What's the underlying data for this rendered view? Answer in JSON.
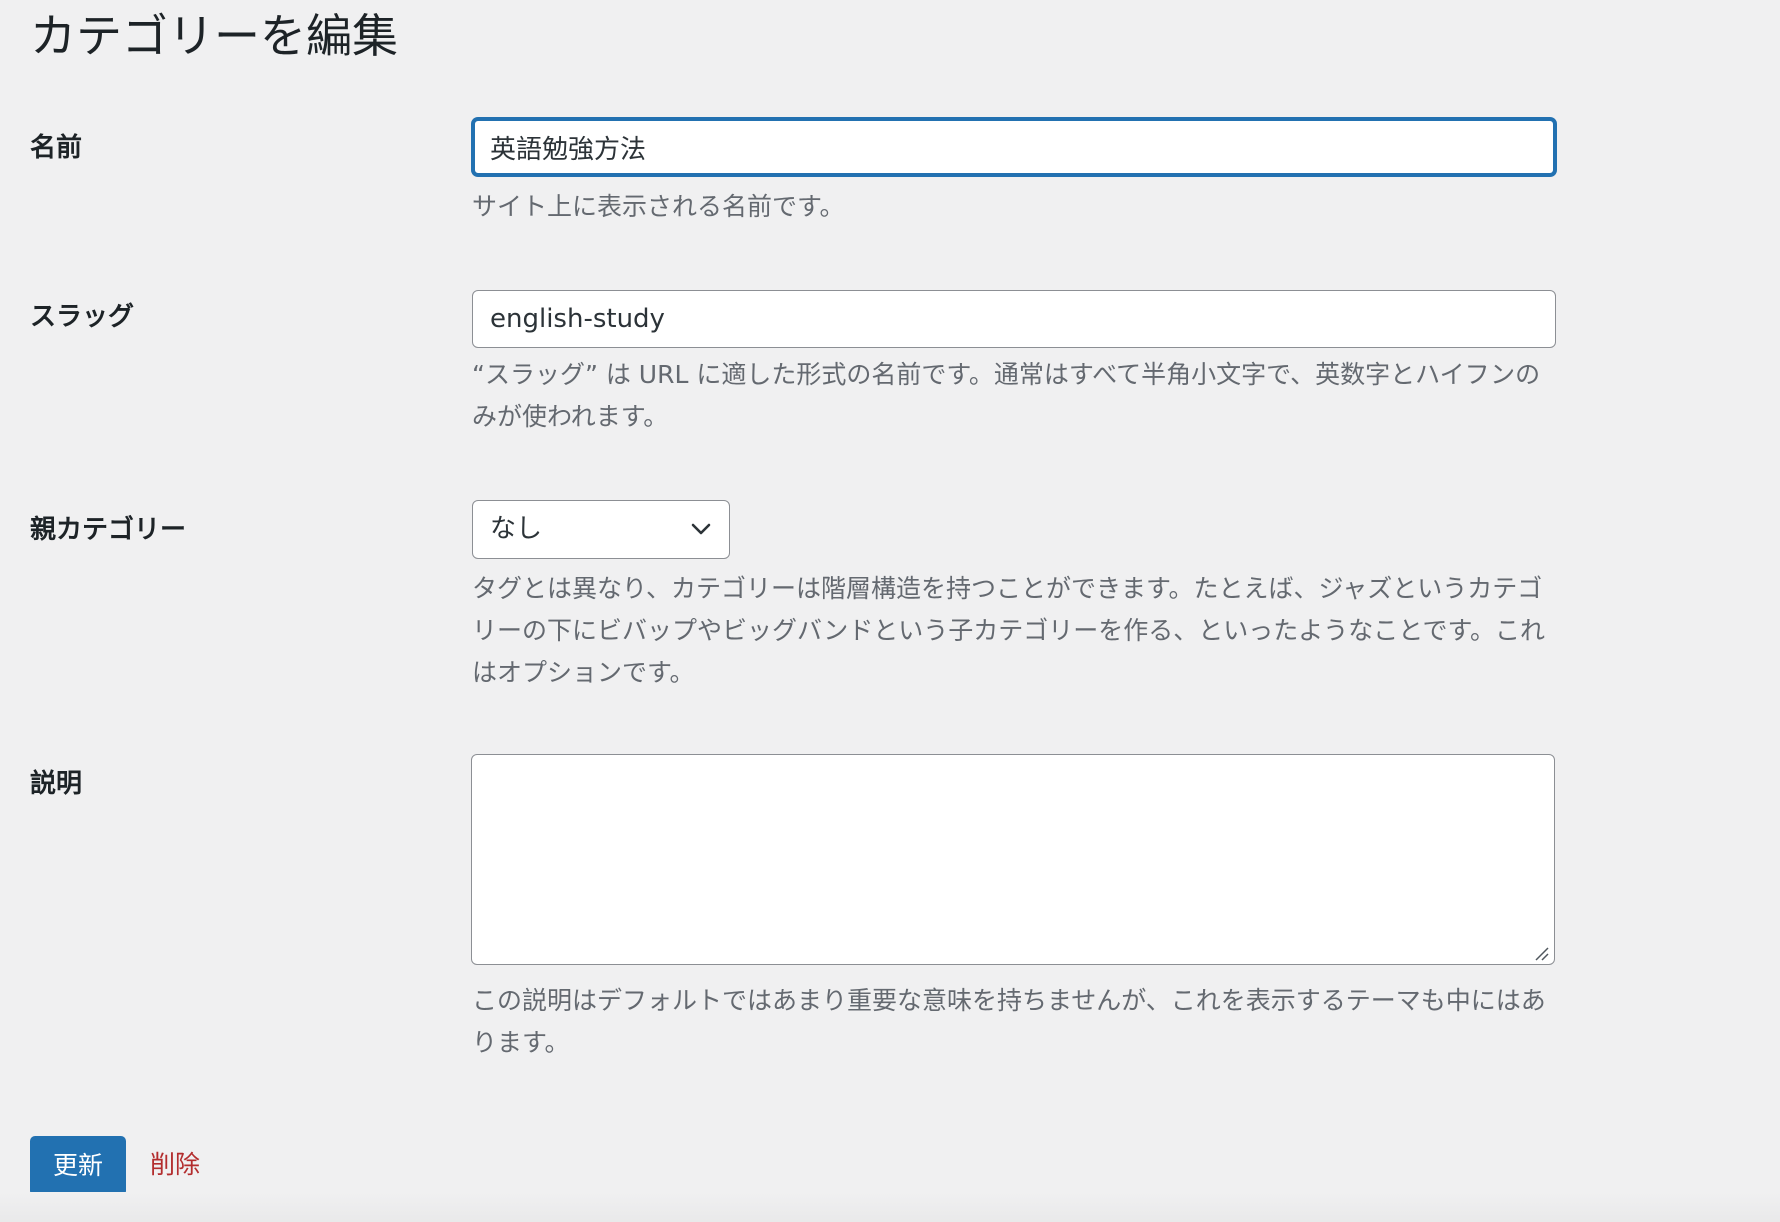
{
  "page": {
    "title": "カテゴリーを編集"
  },
  "fields": {
    "name": {
      "label": "名前",
      "value": "英語勉強方法",
      "description": "サイト上に表示される名前です。"
    },
    "slug": {
      "label": "スラッグ",
      "value": "english-study",
      "description": "“スラッグ” は URL に適した形式の名前です。通常はすべて半角小文字で、英数字とハイフンのみが使われます。"
    },
    "parent": {
      "label": "親カテゴリー",
      "selected": "なし",
      "description": "タグとは異なり、カテゴリーは階層構造を持つことができます。たとえば、ジャズというカテゴリーの下にビバップやビッグバンドという子カテゴリーを作る、といったようなことです。これはオプションです。"
    },
    "description": {
      "label": "説明",
      "value": "",
      "description": "この説明はデフォルトではあまり重要な意味を持ちませんが、これを表示するテーマも中にはあります。"
    }
  },
  "actions": {
    "update_label": "更新",
    "delete_label": "削除"
  },
  "colors": {
    "primary": "#2271b1",
    "delete": "#b32d2e",
    "background": "#f0f0f1",
    "description_text": "#646970"
  },
  "icons": {
    "select_arrow": "chevron-down-icon",
    "textarea_resize": "resize-handle-icon"
  }
}
